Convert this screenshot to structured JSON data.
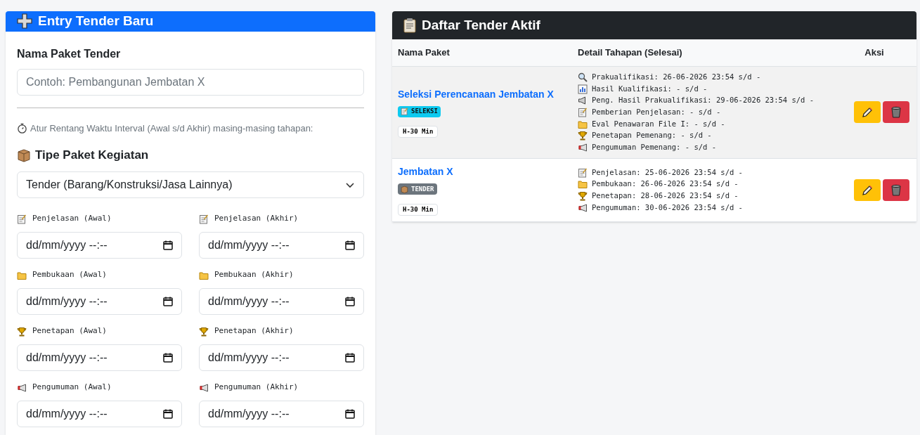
{
  "form": {
    "title": "Entry Tender Baru",
    "name_label": "Nama Paket Tender",
    "name_placeholder": "Contoh: Pembangunan Jembatan X",
    "hint": "Atur Rentang Waktu Interval (Awal s/d Akhir) masing-masing tahapan:",
    "type_label": "Tipe Paket Kegiatan",
    "type_value": "Tender (Barang/Konstruksi/Jasa Lainnya)",
    "date_fields": [
      {
        "kind": "memo",
        "label": "Penjelasan (Awal)",
        "placeholder": "dd/mm/yyyy --:--"
      },
      {
        "kind": "memo",
        "label": "Penjelasan (Akhir)",
        "placeholder": "dd/mm/yyyy --:--"
      },
      {
        "kind": "folder",
        "label": "Pembukaan (Awal)",
        "placeholder": "dd/mm/yyyy --:--"
      },
      {
        "kind": "folder",
        "label": "Pembukaan (Akhir)",
        "placeholder": "dd/mm/yyyy --:--"
      },
      {
        "kind": "trophy",
        "label": "Penetapan (Awal)",
        "placeholder": "dd/mm/yyyy --:--"
      },
      {
        "kind": "trophy",
        "label": "Penetapan (Akhir)",
        "placeholder": "dd/mm/yyyy --:--"
      },
      {
        "kind": "megaphone",
        "label": "Pengumuman (Awal)",
        "placeholder": "dd/mm/yyyy --:--"
      },
      {
        "kind": "megaphone",
        "label": "Pengumuman (Akhir)",
        "placeholder": "dd/mm/yyyy --:--"
      }
    ]
  },
  "list": {
    "title": "Daftar Tender Aktif",
    "columns": [
      "Nama Paket",
      "Detail Tahapan (Selesai)",
      "Aksi"
    ],
    "rows": [
      {
        "name": "Seleksi Perencanaan Jembatan X",
        "badge": {
          "kind": "memo",
          "label": "SELEKSI",
          "color": "#0dcaf0"
        },
        "reminder": "H-30 Min",
        "phases": [
          {
            "kind": "search",
            "text": "Prakualifikasi: 26-06-2026 23:54 s/d -"
          },
          {
            "kind": "chart",
            "text": "Hasil Kualifikasi: - s/d -"
          },
          {
            "kind": "loudspeaker",
            "text": "Peng. Hasil Prakualifikasi: 29-06-2026 23:54 s/d -"
          },
          {
            "kind": "memo",
            "text": "Pemberian Penjelasan: - s/d -"
          },
          {
            "kind": "folder",
            "text": "Eval Penawaran File I: - s/d -"
          },
          {
            "kind": "trophy",
            "text": "Penetapan Pemenang: - s/d -"
          },
          {
            "kind": "megaphone",
            "text": "Pengumuman Pemenang: - s/d -"
          }
        ]
      },
      {
        "name": "Jembatan X",
        "badge": {
          "kind": "box",
          "label": "TENDER",
          "color": "#6c757d"
        },
        "reminder": "H-30 Min",
        "phases": [
          {
            "kind": "memo",
            "text": "Penjelasan: 25-06-2026 23:54 s/d -"
          },
          {
            "kind": "folder",
            "text": "Pembukaan: 26-06-2026 23:54 s/d -"
          },
          {
            "kind": "trophy",
            "text": "Penetapan: 28-06-2026 23:54 s/d -"
          },
          {
            "kind": "megaphone",
            "text": "Pengumuman: 30-06-2026 23:54 s/d -"
          }
        ]
      }
    ]
  }
}
